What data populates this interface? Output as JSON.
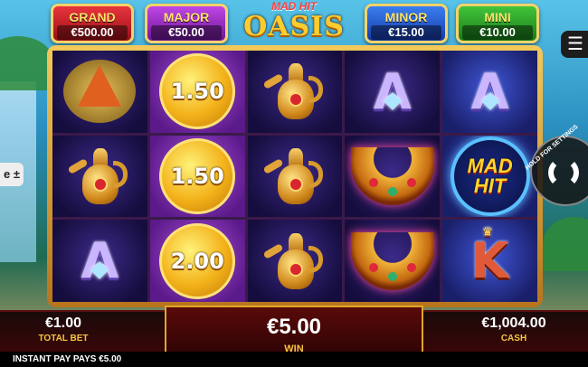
{
  "jackpots": {
    "grand": {
      "name": "GRAND",
      "value": "€500.00"
    },
    "major": {
      "name": "MAJOR",
      "value": "€50.00"
    },
    "minor": {
      "name": "MINOR",
      "value": "€15.00"
    },
    "mini": {
      "name": "MINI",
      "value": "€10.00"
    }
  },
  "logo": {
    "line1": "MAD HIT",
    "line2": "OASIS"
  },
  "side_tab": {
    "label": "e ±"
  },
  "menu": {
    "icon": "hamburger-menu-icon",
    "glyph": "☰"
  },
  "reels": {
    "col1": [
      "spice-pile",
      "golden-lamp",
      "letter-A"
    ],
    "col2": [
      "coin 1.50",
      "coin 1.50",
      "coin 2.00"
    ],
    "col3": [
      "golden-lamp",
      "golden-lamp",
      "golden-lamp"
    ],
    "col4": [
      "letter-A",
      "necklace",
      "necklace"
    ],
    "col5": [
      "letter-A",
      "mad-hit",
      "letter-K"
    ],
    "coin_values": [
      "1.50",
      "1.50",
      "2.00"
    ],
    "letter_a": "A",
    "letter_k": "K",
    "madhit_line1": "MAD",
    "madhit_line2": "HIT"
  },
  "hold_button": {
    "label": "HOLD FOR SETTINGS"
  },
  "bottom": {
    "total_bet_value": "€1.00",
    "total_bet_label": "TOTAL BET",
    "win_value": "€5.00",
    "win_label": "WIN",
    "cash_value": "€1,004.00",
    "cash_label": "CASH"
  },
  "footer": {
    "text": "INSTANT PAY PAYS €5.00"
  }
}
